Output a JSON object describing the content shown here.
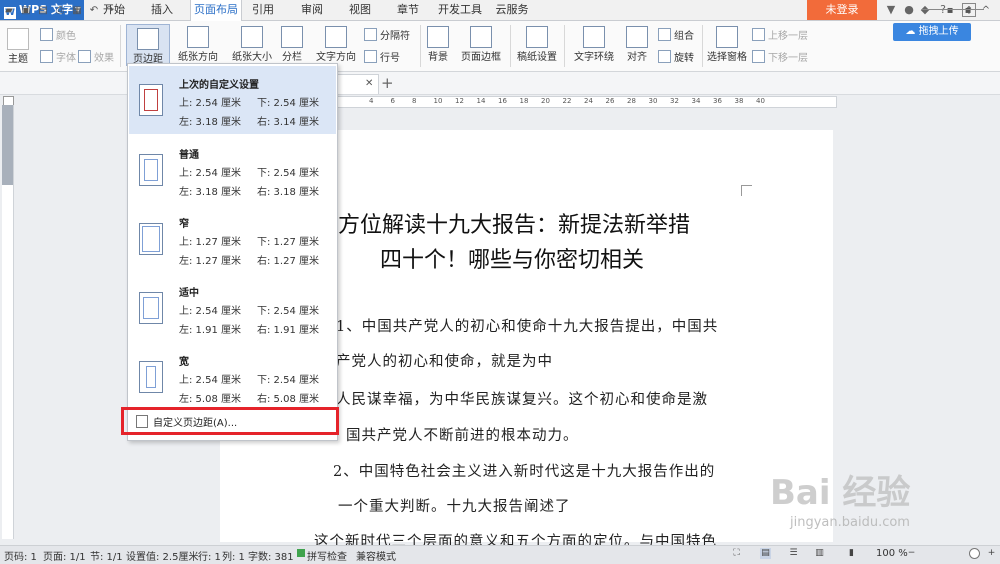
{
  "app": {
    "name": "WPS 文字"
  },
  "tabs": [
    "开始",
    "插入",
    "页面布局",
    "引用",
    "审阅",
    "视图",
    "章节",
    "开发工具",
    "云服务"
  ],
  "active_tab": "页面布局",
  "login_label": "未登录",
  "upload_label": "拖拽上传",
  "ribbon": {
    "theme": "主题",
    "color": "颜色",
    "font": "字体",
    "effect": "效果",
    "margins": "页边距",
    "orientation": "纸张方向",
    "size": "纸张大小",
    "columns": "分栏",
    "text_direction": "文字方向",
    "breaks": "分隔符",
    "line_numbers": "行号",
    "background": "背景",
    "page_border": "页面边框",
    "grid_settings": "稿纸设置",
    "text_wrap": "文字环绕",
    "align": "对齐",
    "group": "组合",
    "rotate": "旋转",
    "selection_pane": "选择窗格",
    "bring_forward": "上移一层",
    "send_backward": "下移一层"
  },
  "margins_menu": {
    "options": [
      {
        "title": "上次的自定义设置",
        "top": "上: 2.54 厘米",
        "bottom": "下: 2.54 厘米",
        "left": "左: 3.18 厘米",
        "right": "右: 3.14 厘米"
      },
      {
        "title": "普通",
        "top": "上: 2.54 厘米",
        "bottom": "下: 2.54 厘米",
        "left": "左: 3.18 厘米",
        "right": "右: 3.18 厘米"
      },
      {
        "title": "窄",
        "top": "上: 1.27 厘米",
        "bottom": "下: 1.27 厘米",
        "left": "左: 1.27 厘米",
        "right": "右: 1.27 厘米"
      },
      {
        "title": "适中",
        "top": "上: 2.54 厘米",
        "bottom": "下: 2.54 厘米",
        "left": "左: 1.91 厘米",
        "right": "右: 1.91 厘米"
      },
      {
        "title": "宽",
        "top": "上: 2.54 厘米",
        "bottom": "下: 2.54 厘米",
        "left": "左: 5.08 厘米",
        "right": "右: 5.08 厘米"
      }
    ],
    "custom_label": "自定义页边距(A)..."
  },
  "document": {
    "title_line1": "方位解读十九大报告：新提法新举措",
    "title_line2": "四十个！哪些与你密切相关",
    "p1": "1、中国共产党人的初心和使命十九大报告提出，中国共",
    "p2": "产党人的初心和使命，就是为中",
    "p3": "人民谋幸福，为中华民族谋复兴。这个初心和使命是激",
    "p4": "国共产党人不断前进的根本动力。",
    "p5": "2、中国特色社会主义进入新时代这是十九大报告作出的",
    "p6": "一个重大判断。十九大报告阐述了",
    "p7": "这个新时代三个层面的意义和五个方面的定位。与中国特色"
  },
  "ruler_numbers": [
    "4",
    "6",
    "8",
    "10",
    "12",
    "14",
    "16",
    "18",
    "20",
    "22",
    "24",
    "26",
    "28",
    "30",
    "32",
    "34",
    "36",
    "38",
    "40"
  ],
  "status": {
    "page_num": "页码: 1",
    "pages": "页面: 1/1",
    "section": "节: 1/1",
    "setting": "设置值: 2.5厘米",
    "row": "行: 1",
    "col": "列: 1",
    "words": "字数: 381",
    "spell": "拼写检查",
    "compat": "兼容模式",
    "zoom": "100 %"
  },
  "watermark": {
    "brand": "Bai 经验",
    "url": "jingyan.baidu.com"
  }
}
